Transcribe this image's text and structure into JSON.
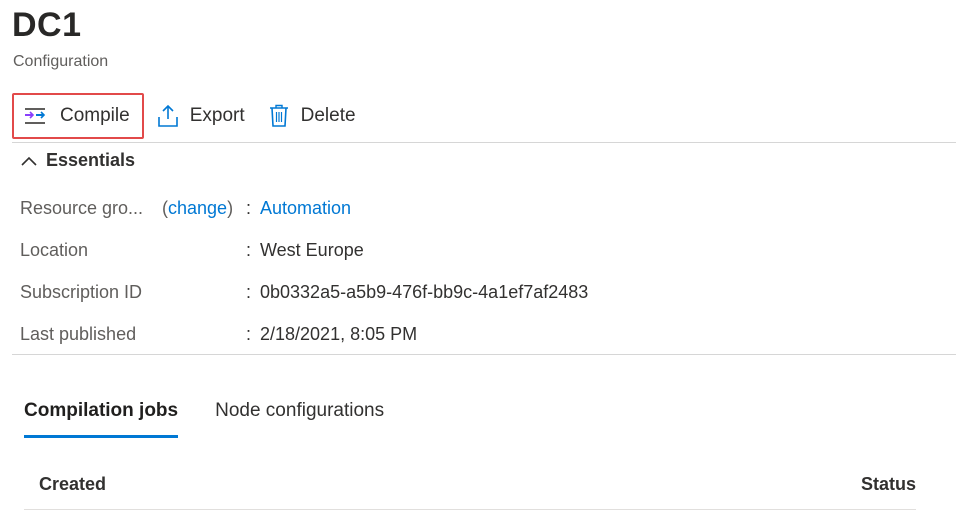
{
  "header": {
    "title": "DC1",
    "subtitle": "Configuration"
  },
  "toolbar": {
    "compile_label": "Compile",
    "export_label": "Export",
    "delete_label": "Delete"
  },
  "essentials": {
    "toggle_label": "Essentials",
    "rows": [
      {
        "label": "Resource gro...",
        "change": "change",
        "value": "Automation"
      },
      {
        "label": "Location",
        "value": "West Europe"
      },
      {
        "label": "Subscription ID",
        "value": "0b0332a5-a5b9-476f-bb9c-4a1ef7af2483"
      },
      {
        "label": "Last published",
        "value": "2/18/2021, 8:05 PM"
      }
    ]
  },
  "tabs": [
    {
      "label": "Compilation jobs",
      "active": true
    },
    {
      "label": "Node configurations",
      "active": false
    }
  ],
  "table": {
    "columns": [
      "Created",
      "Status"
    ]
  },
  "colors": {
    "accent": "#0078d4",
    "highlight_border": "#e24a4a"
  }
}
